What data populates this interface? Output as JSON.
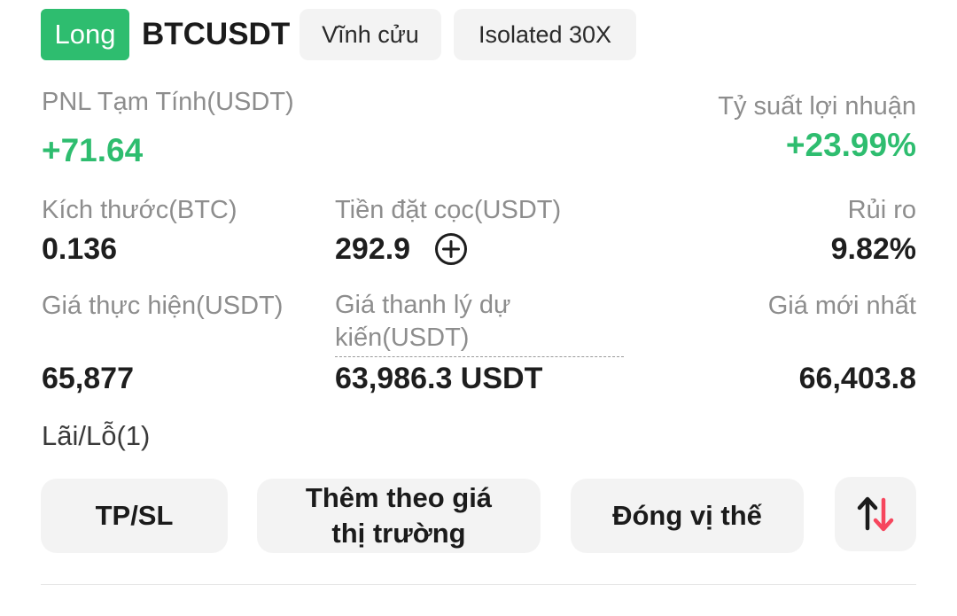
{
  "header": {
    "side": "Long",
    "symbol": "BTCUSDT",
    "contract_type": "Vĩnh cửu",
    "margin_mode": "Isolated 30X"
  },
  "pnl": {
    "label": "PNL Tạm Tính(USDT)",
    "value": "+71.64"
  },
  "roe": {
    "label": "Tỷ suất lợi nhuận",
    "value": "+23.99%"
  },
  "size": {
    "label": "Kích thước(BTC)",
    "value": "0.136"
  },
  "margin": {
    "label": "Tiền đặt cọc(USDT)",
    "value": "292.9"
  },
  "risk": {
    "label": "Rủi ro",
    "value": "9.82%"
  },
  "entry_price": {
    "label": "Giá thực hiện(USDT)",
    "value": "65,877"
  },
  "liq_price": {
    "label": "Giá thanh lý dự kiến(USDT)",
    "value": "63,986.3 USDT"
  },
  "mark_price": {
    "label": "Giá mới nhất",
    "value": "66,403.8"
  },
  "tpsl_count": "Lãi/Lỗ(1)",
  "actions": {
    "tpsl": "TP/SL",
    "add_market": "Thêm theo giá thị trường",
    "close": "Đóng vị thế"
  },
  "colors": {
    "long_green": "#2ebd6f",
    "short_red": "#f6465d",
    "button_bg": "#f3f3f3",
    "label_gray": "#8d8d8d"
  },
  "icons": {
    "add_margin": "plus-circle-icon",
    "reverse": "reverse-arrows-icon"
  }
}
